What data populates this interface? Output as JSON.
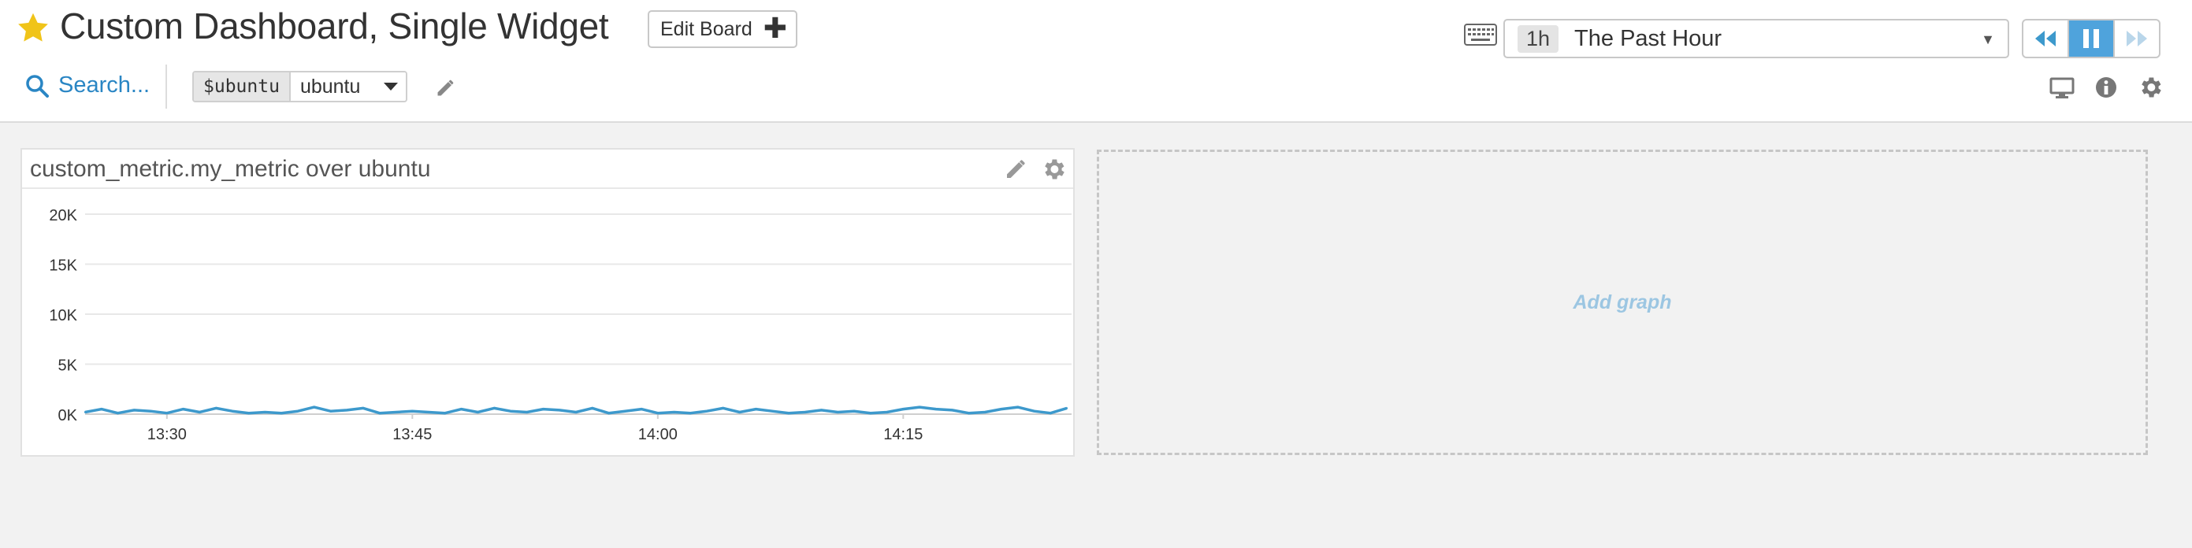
{
  "header": {
    "title": "Custom Dashboard, Single Widget",
    "edit_board_label": "Edit Board",
    "favorite_color": "#f0c419"
  },
  "timeframe": {
    "badge": "1h",
    "label": "The Past Hour",
    "caret": "▼"
  },
  "playback": {
    "buttons": [
      "rewind-icon",
      "pause-icon",
      "fast-forward-icon"
    ],
    "active": "pause"
  },
  "toolbar": {
    "search_label": "Search...",
    "template_variable": {
      "name": "$ubuntu",
      "value": "ubuntu"
    },
    "right_icons": [
      "monitor-icon",
      "info-icon",
      "gear-icon"
    ]
  },
  "widget": {
    "title": "custom_metric.my_metric over ubuntu"
  },
  "chart_data": {
    "type": "line",
    "title": "custom_metric.my_metric over ubuntu",
    "xlabel": "",
    "ylabel": "",
    "y_ticks": [
      "0K",
      "5K",
      "10K",
      "15K",
      "20K"
    ],
    "ylim": [
      0,
      20000
    ],
    "x_ticks": [
      "13:30",
      "13:45",
      "14:00",
      "14:15"
    ],
    "grid": true,
    "series": [
      {
        "color": "#3d99cc",
        "x": [
          "13:25",
          "13:26",
          "13:27",
          "13:28",
          "13:29",
          "13:30",
          "13:31",
          "13:32",
          "13:33",
          "13:34",
          "13:35",
          "13:36",
          "13:37",
          "13:38",
          "13:39",
          "13:40",
          "13:41",
          "13:42",
          "13:43",
          "13:44",
          "13:45",
          "13:46",
          "13:47",
          "13:48",
          "13:49",
          "13:50",
          "13:51",
          "13:52",
          "13:53",
          "13:54",
          "13:55",
          "13:56",
          "13:57",
          "13:58",
          "13:59",
          "14:00",
          "14:01",
          "14:02",
          "14:03",
          "14:04",
          "14:05",
          "14:06",
          "14:07",
          "14:08",
          "14:09",
          "14:10",
          "14:11",
          "14:12",
          "14:13",
          "14:14",
          "14:15",
          "14:16",
          "14:17",
          "14:18",
          "14:19",
          "14:20",
          "14:21",
          "14:22",
          "14:23",
          "14:24",
          "14:25"
        ],
        "values": [
          200,
          500,
          100,
          400,
          300,
          100,
          500,
          200,
          600,
          300,
          100,
          200,
          100,
          300,
          700,
          300,
          400,
          600,
          100,
          200,
          300,
          200,
          100,
          500,
          200,
          600,
          300,
          200,
          500,
          400,
          200,
          600,
          100,
          300,
          500,
          100,
          200,
          100,
          300,
          600,
          200,
          500,
          300,
          100,
          200,
          400,
          200,
          300,
          100,
          200,
          500,
          700,
          500,
          400,
          100,
          200,
          500,
          700,
          300,
          100,
          600
        ]
      }
    ]
  },
  "add_graph": {
    "label": "Add graph"
  }
}
